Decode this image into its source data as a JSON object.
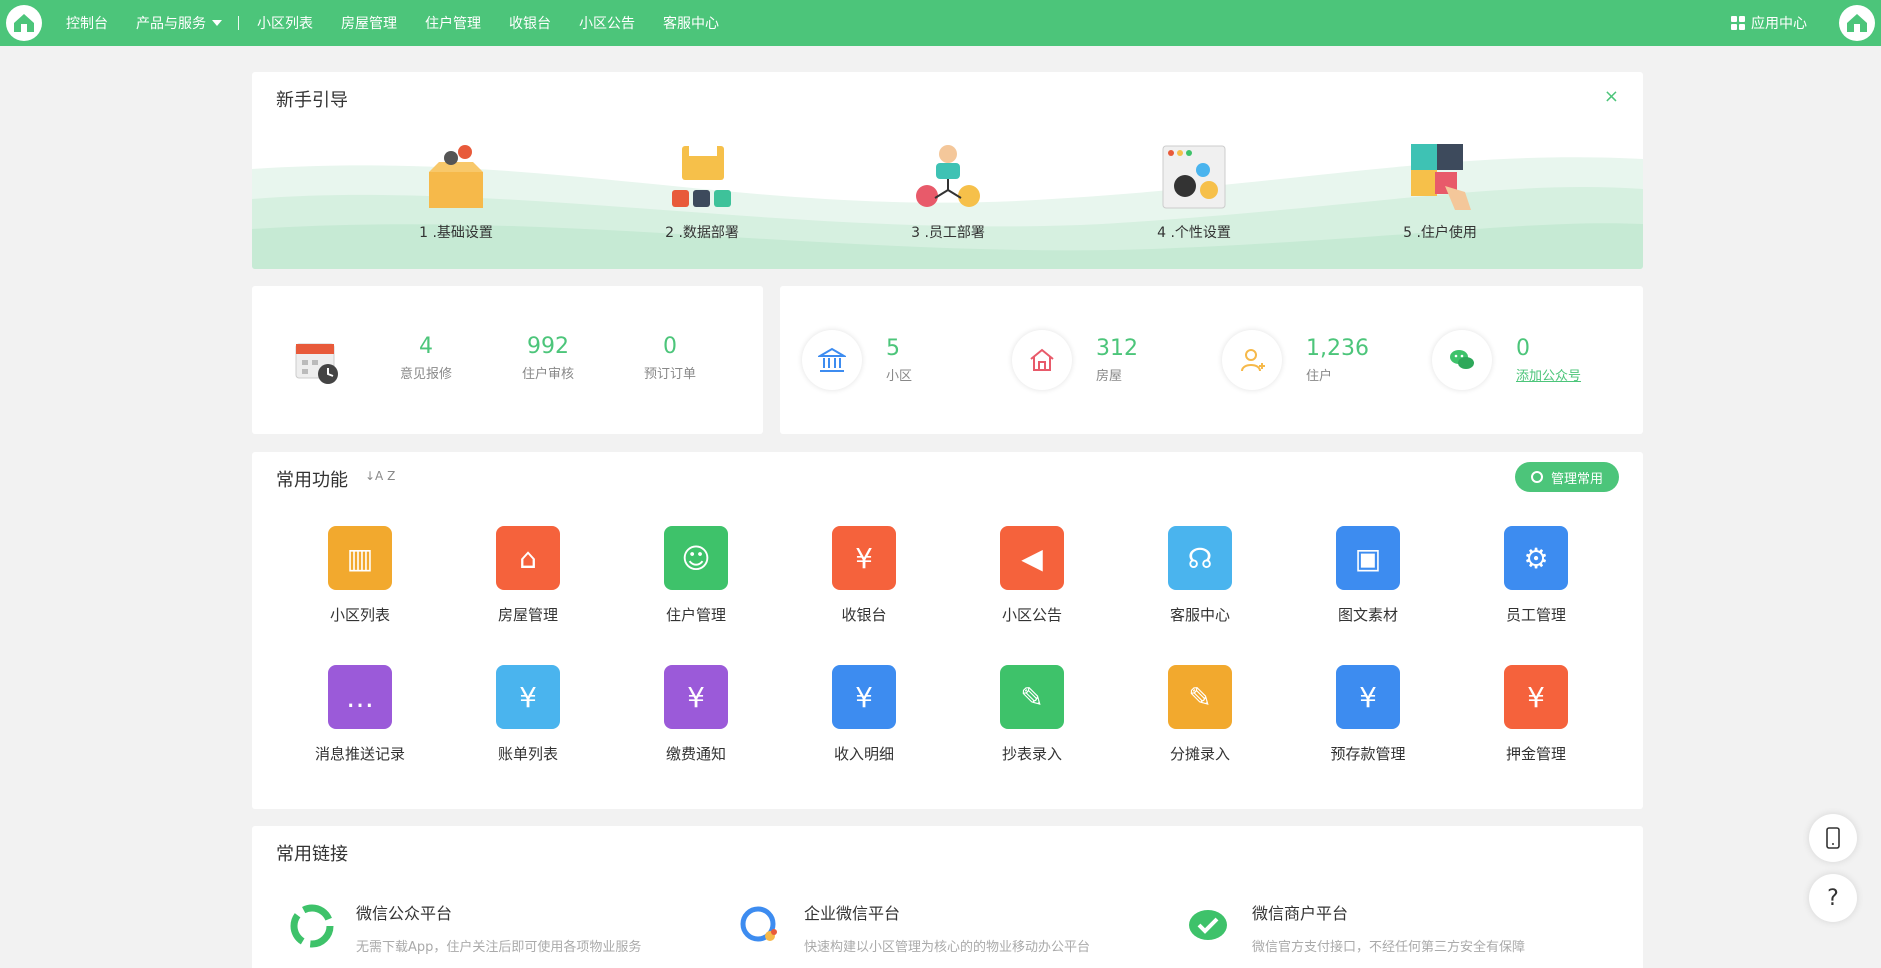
{
  "nav": {
    "console": "控制台",
    "products": "产品与服务",
    "items": [
      "小区列表",
      "房屋管理",
      "住户管理",
      "收银台",
      "小区公告",
      "客服中心"
    ],
    "app_center": "应用中心"
  },
  "guide": {
    "title": "新手引导",
    "close": "×",
    "steps": [
      "1 .基础设置",
      "2 .数据部署",
      "3 .员工部署",
      "4 .个性设置",
      "5 .住户使用"
    ]
  },
  "stats1": [
    {
      "value": "4",
      "label": "意见报修"
    },
    {
      "value": "992",
      "label": "住户审核"
    },
    {
      "value": "0",
      "label": "预订订单"
    }
  ],
  "stats2": [
    {
      "value": "5",
      "label": "小区",
      "icon": "bank-icon"
    },
    {
      "value": "312",
      "label": "房屋",
      "icon": "house-icon"
    },
    {
      "value": "1,236",
      "label": "住户",
      "icon": "add-user-icon"
    },
    {
      "value": "0",
      "label": "添加公众号",
      "icon": "wechat-icon"
    }
  ],
  "freq": {
    "title": "常用功能",
    "sort": "↓A Z",
    "manage": "管理常用",
    "items": [
      {
        "label": "小区列表",
        "color": "#f2a92e"
      },
      {
        "label": "房屋管理",
        "color": "#f5623c"
      },
      {
        "label": "住户管理",
        "color": "#3ec26a"
      },
      {
        "label": "收银台",
        "color": "#f5623c"
      },
      {
        "label": "小区公告",
        "color": "#f5623c"
      },
      {
        "label": "客服中心",
        "color": "#4ab4ee"
      },
      {
        "label": "图文素材",
        "color": "#3d8cf0"
      },
      {
        "label": "员工管理",
        "color": "#3d8cf0"
      },
      {
        "label": "消息推送记录",
        "color": "#9b5ad9"
      },
      {
        "label": "账单列表",
        "color": "#4ab4ee"
      },
      {
        "label": "缴费通知",
        "color": "#9b5ad9"
      },
      {
        "label": "收入明细",
        "color": "#3d8cf0"
      },
      {
        "label": "抄表录入",
        "color": "#3ec26a"
      },
      {
        "label": "分摊录入",
        "color": "#f2a92e"
      },
      {
        "label": "预存款管理",
        "color": "#3d8cf0"
      },
      {
        "label": "押金管理",
        "color": "#f5623c"
      }
    ]
  },
  "links": {
    "title": "常用链接",
    "items": [
      {
        "title": "微信公众平台",
        "desc": "无需下载App，住户关注后即可使用各项物业服务"
      },
      {
        "title": "企业微信平台",
        "desc": "快速构建以小区管理为核心的的物业移动办公平台"
      },
      {
        "title": "微信商户平台",
        "desc": "微信官方支付接口，不经任何第三方安全有保障"
      }
    ]
  },
  "float": {
    "help": "?"
  }
}
